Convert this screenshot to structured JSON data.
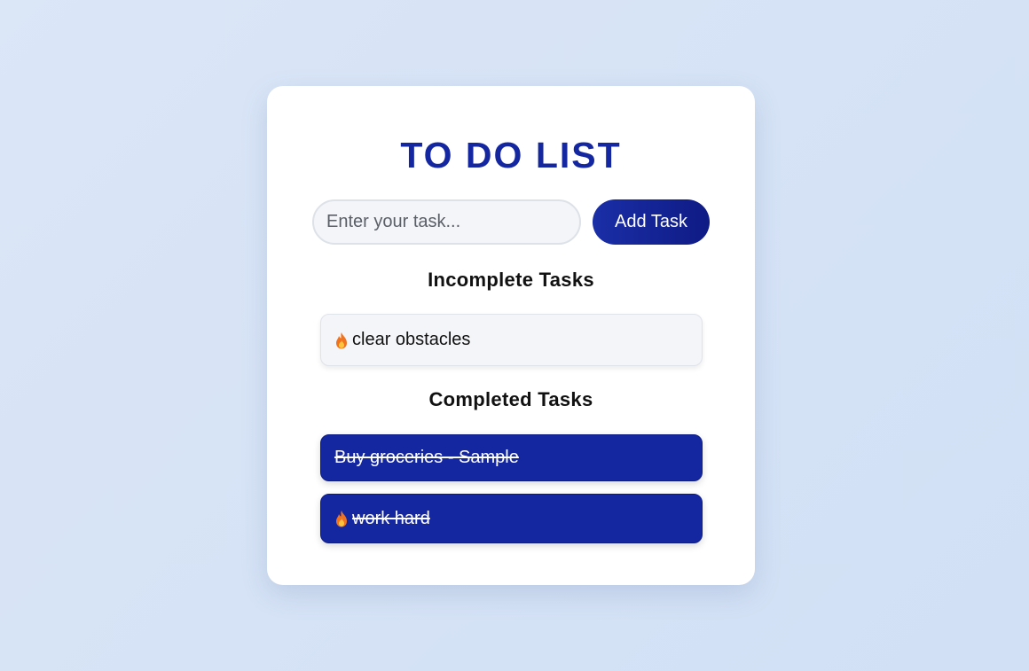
{
  "app": {
    "title": "TO DO LIST"
  },
  "input": {
    "placeholder": "Enter your task...",
    "value": ""
  },
  "add_button": {
    "label": "Add Task"
  },
  "sections": {
    "incomplete": {
      "heading": "Incomplete Tasks",
      "tasks": [
        {
          "text": "clear obstacles",
          "icon": "fire-icon"
        }
      ]
    },
    "completed": {
      "heading": "Completed Tasks",
      "tasks": [
        {
          "text": "Buy groceries - Sample",
          "icon": ""
        },
        {
          "text": "work hard",
          "icon": "fire-icon"
        }
      ]
    }
  },
  "colors": {
    "accent": "#1427a0",
    "background": "#d8e4f6",
    "card": "#ffffff"
  }
}
